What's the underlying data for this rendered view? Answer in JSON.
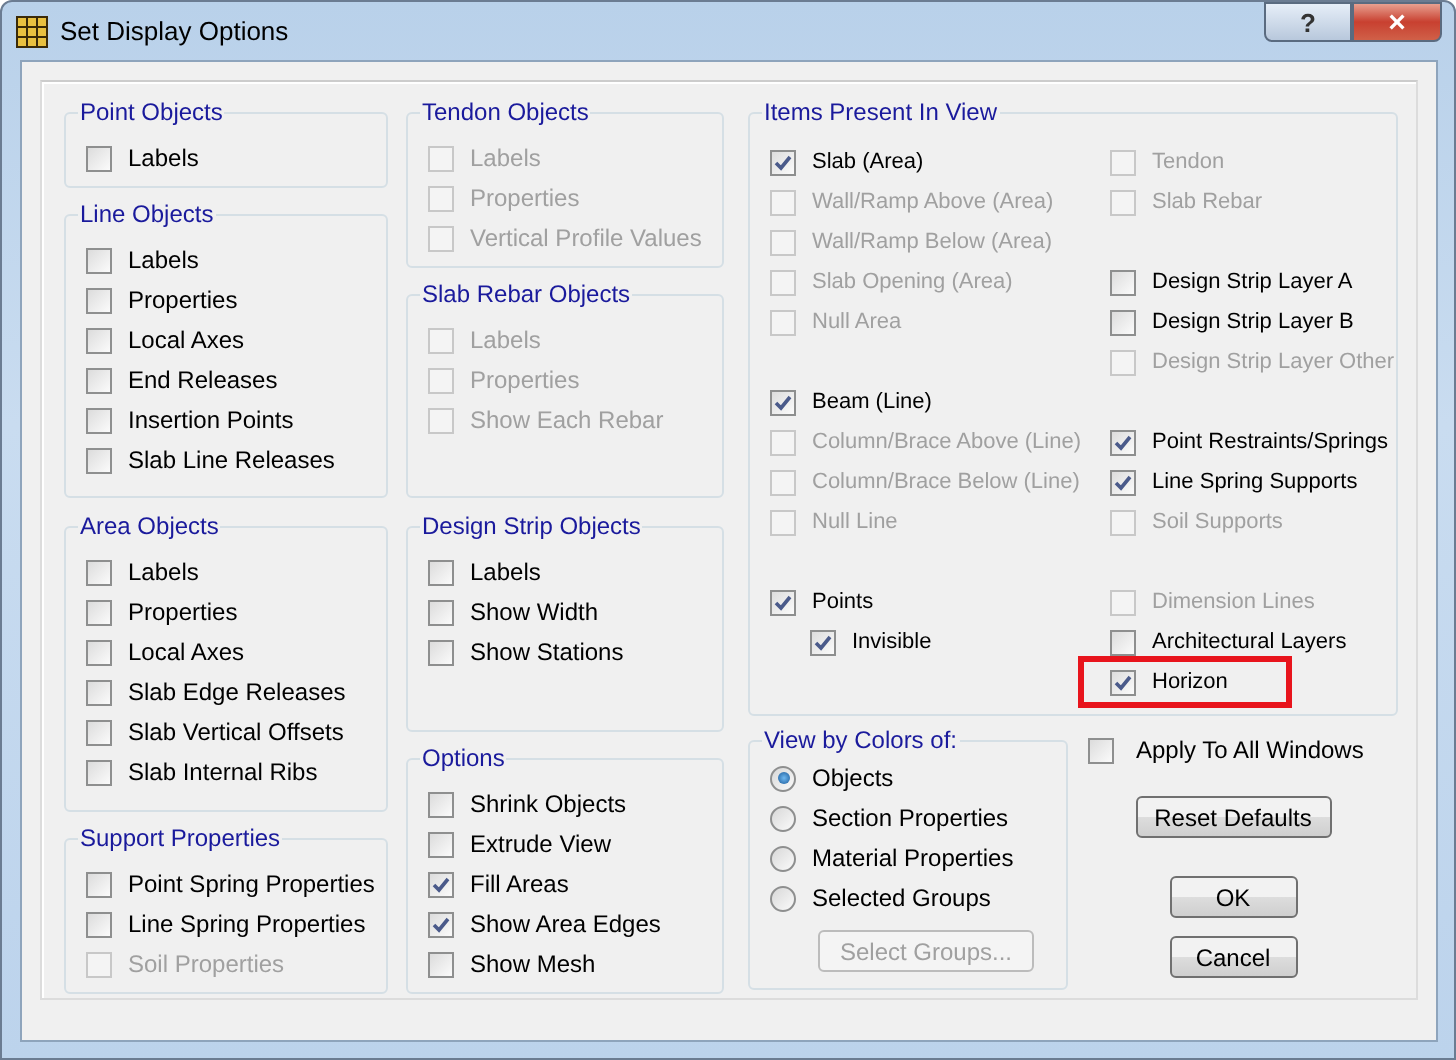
{
  "window": {
    "title": "Set Display Options",
    "help_button": "?",
    "close_button": "×"
  },
  "left_groups": [
    {
      "title": "Point Objects",
      "items": [
        {
          "label": "Labels",
          "checked": false,
          "disabled": false
        }
      ]
    },
    {
      "title": "Line Objects",
      "items": [
        {
          "label": "Labels",
          "checked": false,
          "disabled": false
        },
        {
          "label": "Properties",
          "checked": false,
          "disabled": false
        },
        {
          "label": "Local Axes",
          "checked": false,
          "disabled": false
        },
        {
          "label": "End Releases",
          "checked": false,
          "disabled": false
        },
        {
          "label": "Insertion Points",
          "checked": false,
          "disabled": false
        },
        {
          "label": "Slab Line Releases",
          "checked": false,
          "disabled": false
        }
      ]
    },
    {
      "title": "Area Objects",
      "items": [
        {
          "label": "Labels",
          "checked": false,
          "disabled": false
        },
        {
          "label": "Properties",
          "checked": false,
          "disabled": false
        },
        {
          "label": "Local Axes",
          "checked": false,
          "disabled": false
        },
        {
          "label": "Slab Edge Releases",
          "checked": false,
          "disabled": false
        },
        {
          "label": "Slab Vertical Offsets",
          "checked": false,
          "disabled": false
        },
        {
          "label": "Slab Internal Ribs",
          "checked": false,
          "disabled": false
        }
      ]
    },
    {
      "title": "Support Properties",
      "items": [
        {
          "label": "Point Spring Properties",
          "checked": false,
          "disabled": false
        },
        {
          "label": "Line Spring Properties",
          "checked": false,
          "disabled": false
        },
        {
          "label": "Soil Properties",
          "checked": false,
          "disabled": true
        }
      ]
    }
  ],
  "middle_groups": [
    {
      "title": "Tendon Objects",
      "items": [
        {
          "label": "Labels",
          "checked": false,
          "disabled": true
        },
        {
          "label": "Properties",
          "checked": false,
          "disabled": true
        },
        {
          "label": "Vertical Profile Values",
          "checked": false,
          "disabled": true
        }
      ]
    },
    {
      "title": "Slab Rebar Objects",
      "items": [
        {
          "label": "Labels",
          "checked": false,
          "disabled": true
        },
        {
          "label": "Properties",
          "checked": false,
          "disabled": true
        },
        {
          "label": "Show Each Rebar",
          "checked": false,
          "disabled": true
        }
      ]
    },
    {
      "title": "Design Strip Objects",
      "items": [
        {
          "label": "Labels",
          "checked": false,
          "disabled": false
        },
        {
          "label": "Show Width",
          "checked": false,
          "disabled": false
        },
        {
          "label": "Show Stations",
          "checked": false,
          "disabled": false
        }
      ]
    },
    {
      "title": "Options",
      "items": [
        {
          "label": "Shrink Objects",
          "checked": false,
          "disabled": false
        },
        {
          "label": "Extrude View",
          "checked": false,
          "disabled": false
        },
        {
          "label": "Fill Areas",
          "checked": true,
          "disabled": false
        },
        {
          "label": "Show Area Edges",
          "checked": true,
          "disabled": false
        },
        {
          "label": "Show Mesh",
          "checked": false,
          "disabled": false
        }
      ]
    }
  ],
  "items_present": {
    "title": "Items Present In View",
    "left_sections": [
      {
        "items": [
          {
            "label": "Slab (Area)",
            "checked": true,
            "disabled": false,
            "highlighted": false
          },
          {
            "label": "Wall/Ramp Above (Area)",
            "checked": false,
            "disabled": true,
            "highlighted": false
          },
          {
            "label": "Wall/Ramp Below (Area)",
            "checked": false,
            "disabled": true,
            "highlighted": false
          },
          {
            "label": "Slab Opening (Area)",
            "checked": false,
            "disabled": true,
            "highlighted": false
          },
          {
            "label": "Null Area",
            "checked": false,
            "disabled": true,
            "highlighted": false
          }
        ]
      },
      {
        "items": [
          {
            "label": "Beam (Line)",
            "checked": true,
            "disabled": false,
            "highlighted": false
          },
          {
            "label": "Column/Brace Above (Line)",
            "checked": false,
            "disabled": true,
            "highlighted": false
          },
          {
            "label": "Column/Brace Below (Line)",
            "checked": false,
            "disabled": true,
            "highlighted": false
          },
          {
            "label": "Null Line",
            "checked": false,
            "disabled": true,
            "highlighted": false
          }
        ]
      },
      {
        "items": [
          {
            "label": "Points",
            "checked": true,
            "disabled": false,
            "highlighted": false,
            "children": [
              {
                "label": "Invisible",
                "checked": true,
                "disabled": false,
                "highlighted": false
              }
            ]
          }
        ]
      }
    ],
    "right_sections": [
      {
        "items": [
          {
            "label": "Tendon",
            "checked": false,
            "disabled": true,
            "highlighted": false
          },
          {
            "label": "Slab Rebar",
            "checked": false,
            "disabled": true,
            "highlighted": false
          }
        ]
      },
      {
        "items": [
          {
            "label": "Design Strip Layer A",
            "checked": false,
            "disabled": false,
            "highlighted": false
          },
          {
            "label": "Design Strip Layer B",
            "checked": false,
            "disabled": false,
            "highlighted": false
          },
          {
            "label": "Design Strip Layer Other",
            "checked": false,
            "disabled": true,
            "highlighted": false
          }
        ]
      },
      {
        "items": [
          {
            "label": "Point Restraints/Springs",
            "checked": true,
            "disabled": false,
            "highlighted": false
          },
          {
            "label": "Line Spring Supports",
            "checked": true,
            "disabled": false,
            "highlighted": false
          },
          {
            "label": "Soil Supports",
            "checked": false,
            "disabled": true,
            "highlighted": false
          }
        ]
      },
      {
        "items": [
          {
            "label": "Dimension Lines",
            "checked": false,
            "disabled": true,
            "highlighted": false
          },
          {
            "label": "Architectural Layers",
            "checked": false,
            "disabled": false,
            "highlighted": false
          },
          {
            "label": "Horizon",
            "checked": true,
            "disabled": false,
            "highlighted": true
          }
        ]
      }
    ]
  },
  "view_by_colors": {
    "title": "View by Colors of:",
    "options": [
      {
        "label": "Objects",
        "selected": true
      },
      {
        "label": "Section Properties",
        "selected": false
      },
      {
        "label": "Material Properties",
        "selected": false
      },
      {
        "label": "Selected Groups",
        "selected": false
      }
    ],
    "button": {
      "label": "Select Groups...",
      "disabled": true
    }
  },
  "apply_to_all": {
    "label": "Apply To All Windows",
    "checked": false,
    "disabled": false
  },
  "buttons": [
    {
      "label": "Reset Defaults"
    },
    {
      "label": "OK"
    },
    {
      "label": "Cancel"
    }
  ]
}
